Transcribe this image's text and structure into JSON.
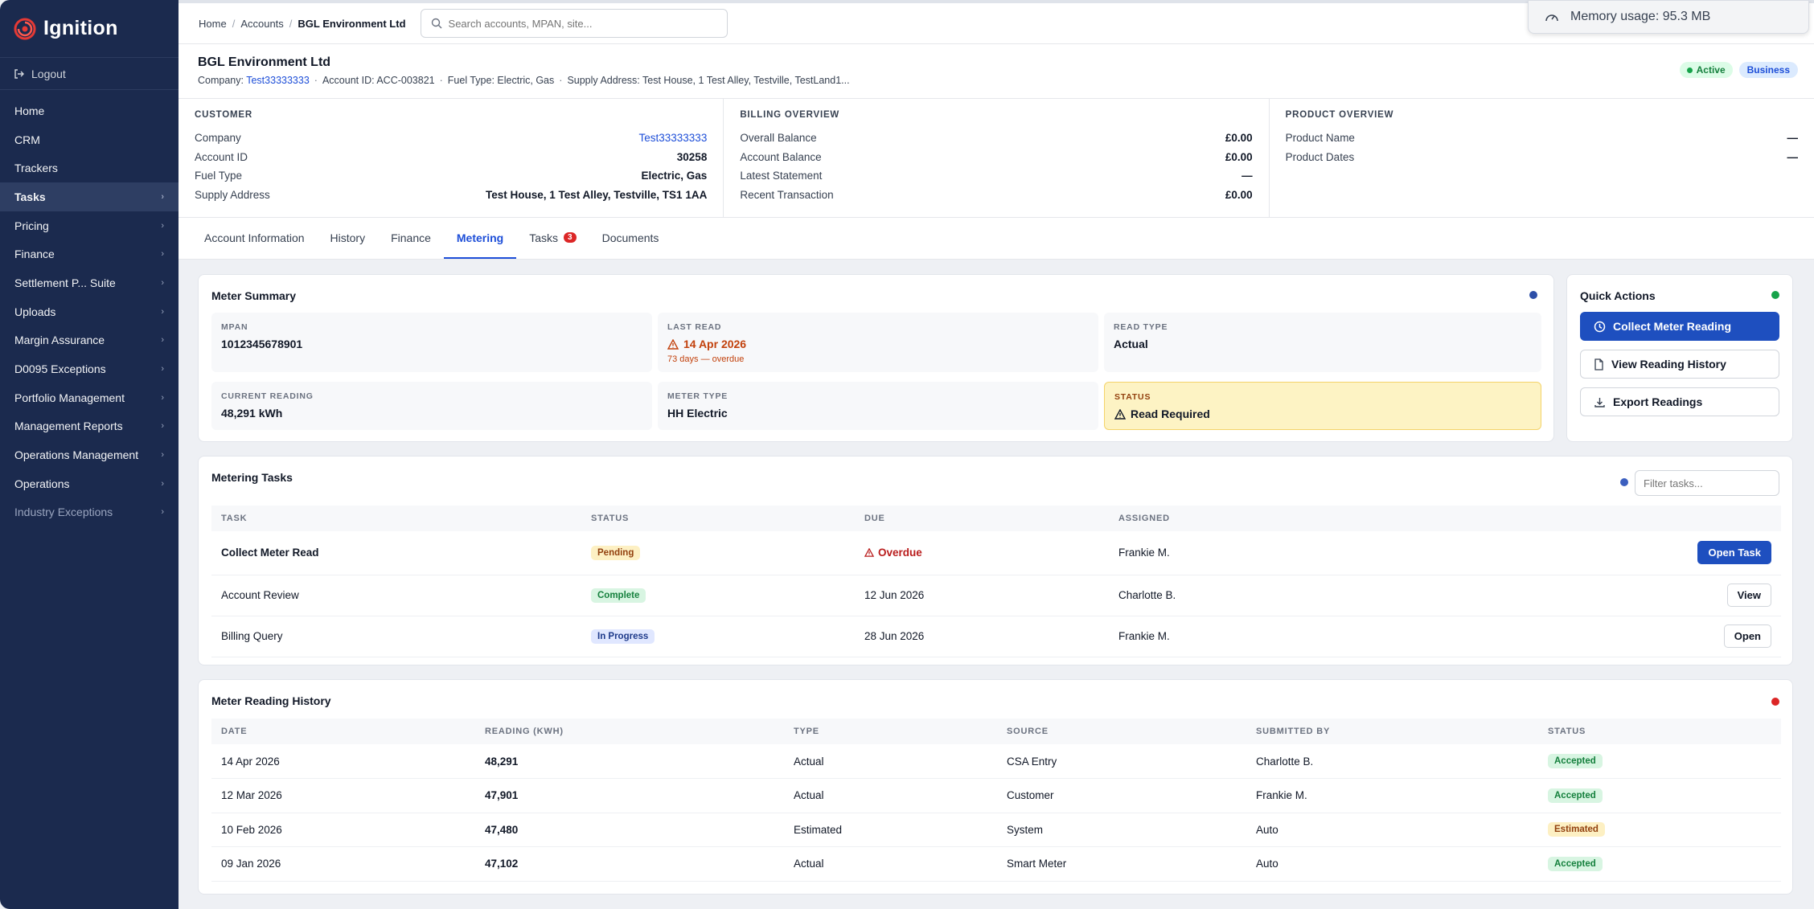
{
  "app": {
    "name": "Ignition",
    "brand_color": "#1b2a4e",
    "accent_color": "#1e4fbf"
  },
  "memory": {
    "label": "Memory usage: 95.3 MB"
  },
  "sidebar": {
    "logout": "Logout",
    "items": [
      {
        "label": "Home",
        "chevron": false
      },
      {
        "label": "CRM",
        "chevron": false
      },
      {
        "label": "Trackers",
        "chevron": false
      },
      {
        "label": "Tasks",
        "chevron": true,
        "active": true
      },
      {
        "label": "Pricing",
        "chevron": true
      },
      {
        "label": "Finance",
        "chevron": true
      },
      {
        "label": "Settlement P... Suite",
        "chevron": true
      },
      {
        "label": "Uploads",
        "chevron": true
      },
      {
        "label": "Margin Assurance",
        "chevron": true
      },
      {
        "label": "D0095 Exceptions",
        "chevron": true
      },
      {
        "label": "Portfolio Management",
        "chevron": true
      },
      {
        "label": "Management Reports",
        "chevron": true
      },
      {
        "label": "Operations Management",
        "chevron": true
      },
      {
        "label": "Operations",
        "chevron": true
      },
      {
        "label": "Industry Exceptions",
        "chevron": true,
        "dim": true
      }
    ]
  },
  "breadcrumb": {
    "home": "Home",
    "accounts": "Accounts",
    "current": "BGL Environment Ltd"
  },
  "search": {
    "placeholder": "Search accounts, MPAN, site..."
  },
  "account": {
    "name": "BGL Environment Ltd",
    "company_label": "Company:",
    "company": "Test33333333",
    "account_id": "Account ID: ACC-003821",
    "fuel_type": "Fuel Type: Electric, Gas",
    "supply_address": "Supply Address: Test House, 1 Test Alley, Testville, TestLand1...",
    "status_badge": "Active",
    "segment_badge": "Business"
  },
  "overview": {
    "customer": {
      "title": "CUSTOMER",
      "rows": [
        {
          "label": "Company",
          "value": "Test33333333"
        },
        {
          "label": "Account ID",
          "value": "30258"
        },
        {
          "label": "Fuel Type",
          "value": "Electric, Gas"
        },
        {
          "label": "Supply Address",
          "value": "Test House, 1 Test Alley, Testville, TS1 1AA"
        }
      ]
    },
    "billing": {
      "title": "BILLING OVERVIEW",
      "rows": [
        {
          "label": "Overall Balance",
          "value": "£0.00"
        },
        {
          "label": "Account Balance",
          "value": "£0.00"
        },
        {
          "label": "Latest Statement",
          "value": "—"
        },
        {
          "label": "Recent Transaction",
          "value": "£0.00"
        }
      ]
    },
    "product": {
      "title": "PRODUCT OVERVIEW",
      "rows": [
        {
          "label": "Product Name",
          "value": "—"
        },
        {
          "label": "Product Dates",
          "value": "—"
        }
      ]
    }
  },
  "tabs": [
    {
      "label": "Account Information"
    },
    {
      "label": "History"
    },
    {
      "label": "Finance"
    },
    {
      "label": "Metering",
      "active": true
    },
    {
      "label": "Tasks",
      "count": "3"
    },
    {
      "label": "Documents"
    }
  ],
  "meter_summary": {
    "title": "Meter Summary",
    "status_color": "#2d4fa8",
    "mpan_label": "MPAN",
    "mpan": "1012345678901",
    "last_read_label": "LAST READ",
    "last_read": "14 Apr 2026",
    "last_read_sub": "73 days — overdue",
    "read_type_label": "READ TYPE",
    "read_type": "Actual",
    "current_reading_label": "CURRENT READING",
    "current_reading": "48,291 kWh",
    "meter_type_label": "METER TYPE",
    "meter_type": "HH Electric",
    "status_label": "STATUS",
    "status": "Read Required"
  },
  "quick_actions": {
    "title": "Quick Actions",
    "status_color": "#16a34a",
    "collect": "Collect Meter Reading",
    "history": "View Reading History",
    "export": "Export Readings"
  },
  "metering_tasks": {
    "title": "Metering Tasks",
    "status_color": "#3b5fbf",
    "filter_placeholder": "Filter tasks...",
    "columns": [
      "TASK",
      "STATUS",
      "DUE",
      "ASSIGNED"
    ],
    "rows": [
      {
        "task": "Collect Meter Read",
        "status": "Pending",
        "status_kind": "pending",
        "due": "Overdue",
        "due_overdue": true,
        "assigned": "Frankie M.",
        "action": "Open Task",
        "action_primary": true
      },
      {
        "task": "Account Review",
        "status": "Complete",
        "status_kind": "complete",
        "due": "12 Jun 2026",
        "assigned": "Charlotte B.",
        "action": "View"
      },
      {
        "task": "Billing Query",
        "status": "In Progress",
        "status_kind": "progress",
        "due": "28 Jun 2026",
        "assigned": "Frankie M.",
        "action": "Open"
      }
    ]
  },
  "reading_history": {
    "title": "Meter Reading History",
    "status_color": "#dc2626",
    "columns": [
      "DATE",
      "READING (KWH)",
      "TYPE",
      "SOURCE",
      "SUBMITTED BY",
      "STATUS"
    ],
    "rows": [
      {
        "date": "14 Apr 2026",
        "reading": "48,291",
        "type": "Actual",
        "source": "CSA Entry",
        "submitted_by": "Charlotte B.",
        "status": "Accepted",
        "status_kind": "accepted"
      },
      {
        "date": "12 Mar 2026",
        "reading": "47,901",
        "type": "Actual",
        "source": "Customer",
        "submitted_by": "Frankie M.",
        "status": "Accepted",
        "status_kind": "accepted"
      },
      {
        "date": "10 Feb 2026",
        "reading": "47,480",
        "type": "Estimated",
        "source": "System",
        "submitted_by": "Auto",
        "status": "Estimated",
        "status_kind": "estimated"
      },
      {
        "date": "09 Jan 2026",
        "reading": "47,102",
        "type": "Actual",
        "source": "Smart Meter",
        "submitted_by": "Auto",
        "status": "Accepted",
        "status_kind": "accepted"
      }
    ]
  }
}
